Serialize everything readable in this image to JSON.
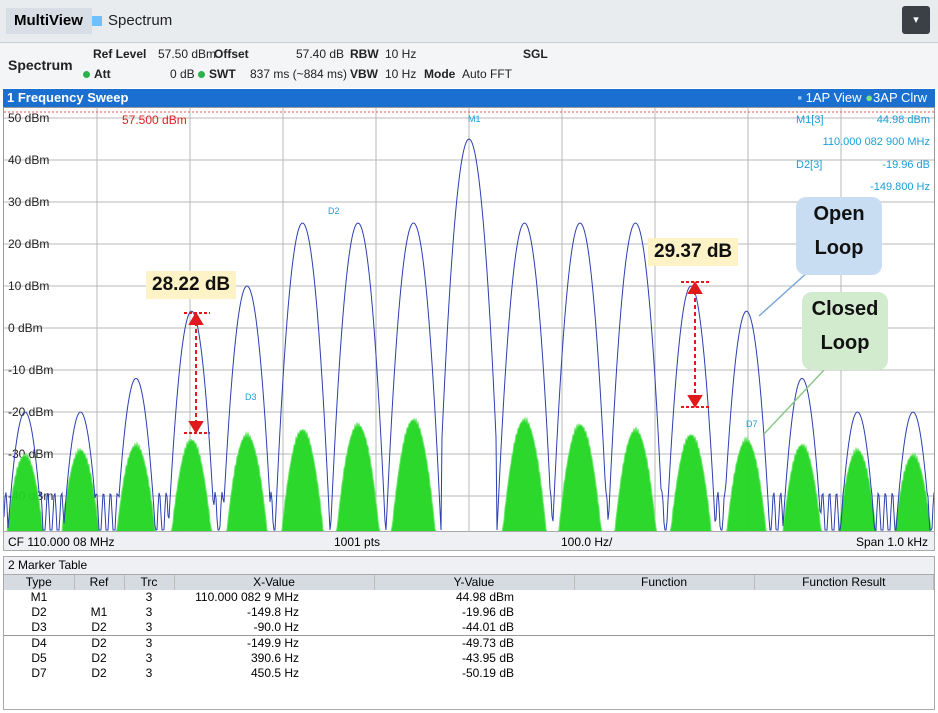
{
  "topbar": {
    "tab_multiview": "MultiView",
    "tab_spectrum": "Spectrum",
    "dropdown_icon": "▾"
  },
  "params": {
    "window_label": "Spectrum",
    "ref_level_label": "Ref Level",
    "ref_level_value": "57.50 dBm",
    "offset_label": "Offset",
    "offset_value": "57.40 dB",
    "rbw_label": "RBW",
    "rbw_value": "10 Hz",
    "sgl": "SGL",
    "att_label": "Att",
    "att_value": "0 dB",
    "swt_label": "SWT",
    "swt_value": "837 ms (~884 ms)",
    "vbw_label": "VBW",
    "vbw_value": "10 Hz",
    "mode_label": "Mode",
    "mode_value": "Auto FFT"
  },
  "sweep": {
    "title": "1 Frequency Sweep",
    "view1": "1AP View",
    "view3": "3AP Clrw",
    "ref_marker": "57.500 dBm",
    "y_ticks": [
      "50 dBm",
      "40 dBm",
      "30 dBm",
      "20 dBm",
      "10 dBm",
      "0 dBm",
      "-10 dBm",
      "-20 dBm",
      "-30 dBm",
      "-40 dBm"
    ],
    "marker_info": {
      "m1_label": "M1[3]",
      "m1_level": "44.98 dBm",
      "m1_freq": "110.000 082 900 MHz",
      "d2_label": "D2[3]",
      "d2_level": "-19.96 dB",
      "d2_freq": "-149.800 Hz"
    },
    "trace_markers": [
      "M1",
      "D2",
      "D3",
      "D7"
    ]
  },
  "footer": {
    "cf": "CF 110.000 08 MHz",
    "pts": "1001 pts",
    "div": "100.0 Hz/",
    "span": "Span 1.0 kHz"
  },
  "marker_table": {
    "title": "2 Marker Table",
    "headers": [
      "Type",
      "Ref",
      "Trc",
      "X-Value",
      "Y-Value",
      "Function",
      "Function Result"
    ],
    "rows": [
      {
        "type": "M1",
        "ref": "",
        "trc": "3",
        "x": "110.000 082 9 MHz",
        "y": "44.98 dBm"
      },
      {
        "type": "D2",
        "ref": "M1",
        "trc": "3",
        "x": "-149.8 Hz",
        "y": "-19.96 dB"
      },
      {
        "type": "D3",
        "ref": "D2",
        "trc": "3",
        "x": "-90.0 Hz",
        "y": "-44.01 dB"
      },
      {
        "type": "D4",
        "ref": "D2",
        "trc": "3",
        "x": "-149.9 Hz",
        "y": "-49.73 dB"
      },
      {
        "type": "D5",
        "ref": "D2",
        "trc": "3",
        "x": "390.6 Hz",
        "y": "-43.95 dB"
      },
      {
        "type": "D7",
        "ref": "D2",
        "trc": "3",
        "x": "450.5 Hz",
        "y": "-50.19 dB"
      }
    ]
  },
  "annotations": {
    "left_delta": "28.22 dB",
    "right_delta": "29.37 dB",
    "open_loop_line1": "Open",
    "open_loop_line2": "Loop",
    "closed_loop_line1": "Closed",
    "closed_loop_line2": "Loop"
  },
  "colors": {
    "open_loop_trace": "#2c3fb0",
    "closed_loop_trace": "#22d622",
    "header_blue": "#1a6fd0",
    "marker_cyan": "#1a9fd8",
    "delta_red": "#e01a1a",
    "open_bubble": "#c8dcf2",
    "closed_bubble": "#d2ebcf"
  }
}
